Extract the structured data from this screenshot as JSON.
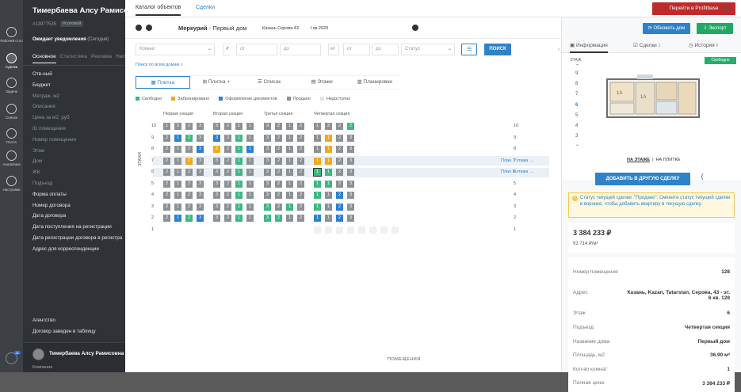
{
  "rail": [
    {
      "label": "Рабочий стол",
      "active": false
    },
    {
      "label": "Сделки",
      "active": true
    },
    {
      "label": "Задачи",
      "active": false
    },
    {
      "label": "Списки",
      "active": false
    },
    {
      "label": "Почта",
      "active": false
    },
    {
      "label": "Аналитика",
      "active": false
    },
    {
      "label": "Настройки",
      "active": false
    }
  ],
  "rail_badge": "31",
  "crm": {
    "name": "Тимербаева Алсу Рамисовна",
    "id": "#13977535",
    "tag": "#сотовой",
    "stage": "Ожидает уведомления",
    "stage_sub": "(Сегодня)",
    "tabs": [
      "Основное",
      "Статистика",
      "Реклама",
      "Нап"
    ],
    "fields": [
      "Отв-ный",
      "Бюджет",
      "Метраж, м2",
      "Описание",
      "Цена за м2, руб",
      "ID помещения",
      "Номер помещения",
      "Этаж",
      "Дом",
      "ЖК",
      "Подъезд",
      "Форма оплаты",
      "Номер договора",
      "Дата договора",
      "Дата поступления на регистрации",
      "Дата регистрации договора в регистра",
      "Адрес для корреспонденции"
    ],
    "fields_bottom": [
      "Агентство",
      "Договор заведен в таблицу"
    ],
    "bottom_user": "Тимербаева Алсу Рамисовна",
    "bottom_sub": "Компания"
  },
  "top": {
    "tabs": [
      "Каталог объектов",
      "Сделки"
    ],
    "profit_button": "Перейти в Profitbase"
  },
  "header": {
    "title": "Меркурий",
    "title_sub": "- Первый дом",
    "address": "Казань Серова 43",
    "quarter": "I кв 2020"
  },
  "filters": {
    "complex": "Комнат",
    "price_unit": "₽",
    "price_from": "от",
    "price_to": "до",
    "area_unit": "м²",
    "area_from": "от",
    "area_to": "до",
    "status": "Статус",
    "search": "ПОИСК",
    "search_all": "Поиск по всем домам"
  },
  "views": [
    "Плитка",
    "Плитка +",
    "Список",
    "Этажи",
    "Планировки"
  ],
  "legend": [
    {
      "label": "Свободно",
      "color": "#3db882"
    },
    {
      "label": "Забронировано",
      "color": "#f0a81e"
    },
    {
      "label": "Оформление документов",
      "color": "#2e7fd1"
    },
    {
      "label": "Продано",
      "color": "#8c9196"
    },
    {
      "label": "Недоступно",
      "color": "#dfe3e7"
    }
  ],
  "sections": [
    "Первая секция",
    "Вторая секция",
    "Третья секция",
    "Четвертая секция"
  ],
  "floors_axis": "ЭТАЖИ",
  "floors": [
    10,
    9,
    8,
    7,
    6,
    5,
    4,
    3,
    2,
    1
  ],
  "highlight_floors": [
    7,
    6
  ],
  "plans": [
    {
      "floor": 7,
      "text": "План",
      "num": "7",
      "suffix": "этажа"
    },
    {
      "floor": 6,
      "text": "План",
      "num": "6",
      "suffix": "этажа"
    }
  ],
  "chess_footer": "ПОМЕЩЕНИЯ",
  "units": {
    "10": [
      "s1g",
      "s2g",
      "s2g",
      "s3g",
      "s3g",
      "s2g",
      "s1g",
      "s1g",
      "s3g",
      "s2g",
      "s1g",
      "s2g",
      "s1g",
      "s2g",
      "s2g",
      "s2f"
    ],
    "9": [
      "s2g",
      "s1b",
      "s2f",
      "s3g",
      "s3b",
      "s2g",
      "s1f",
      "s1g",
      "s3g",
      "s2g",
      "s1g",
      "s2g",
      "s1g",
      "s1o",
      "s2g",
      "s3g"
    ],
    "8": [
      "s2g",
      "s1g",
      "s2g",
      "s3b",
      "s3o",
      "s2g",
      "s1f",
      "s1b",
      "s3g",
      "s2g",
      "s1g",
      "s2g",
      "s1g",
      "s1o",
      "s2g",
      "s3g"
    ],
    "7": [
      "s2g",
      "s1g",
      "s2o",
      "s3g",
      "s3g",
      "s2g",
      "s1f",
      "s1g",
      "s3g",
      "s2g",
      "s1g",
      "s2g",
      "s1o",
      "s1o",
      "s2g",
      "s3g"
    ],
    "6": [
      "s2g",
      "s1g",
      "s2g",
      "s3g",
      "s3g",
      "s2g",
      "s1f",
      "s1g",
      "s3g",
      "s2g",
      "s1g",
      "s2g",
      "s1x",
      "s1f",
      "s2g",
      "s3g"
    ],
    "5": [
      "s2g",
      "s1g",
      "s2g",
      "s3g",
      "s3g",
      "s2g",
      "s1f",
      "s1g",
      "s3g",
      "s2g",
      "s1g",
      "s2g",
      "s1f",
      "s1f",
      "s2g",
      "s3g"
    ],
    "4": [
      "s2g",
      "s1g",
      "s2g",
      "s3g",
      "s3g",
      "s2g",
      "s1f",
      "s1g",
      "s3g",
      "s2g",
      "s1g",
      "s2g",
      "s1f",
      "s1g",
      "s2b",
      "s3g"
    ],
    "3": [
      "s2g",
      "s1g",
      "s2g",
      "s3g",
      "s3g",
      "s2g",
      "s1f",
      "s1g",
      "s3f",
      "s2g",
      "s1f",
      "s2g",
      "s1f",
      "s1g",
      "s2b",
      "s3g"
    ],
    "2": [
      "s2g",
      "s1b",
      "s2f",
      "s3b",
      "s3g",
      "s2g",
      "s1f",
      "s1g",
      "s3f",
      "s2f",
      "s1g",
      "s2g",
      "s1b",
      "s1g",
      "s2b",
      "s3g"
    ]
  },
  "right": {
    "update_button": "Обновить дом",
    "export_button": "Экспорт",
    "tabs": [
      {
        "label": "Информация",
        "count": ""
      },
      {
        "label": "Сделки",
        "count": "1"
      },
      {
        "label": "История",
        "count": "6"
      }
    ],
    "floor_label": "ЭТАЖ",
    "floor_list": [
      "9",
      "8",
      "7",
      "6",
      "5",
      "4",
      "3"
    ],
    "current_floor": "6",
    "status_badge": "Свободно",
    "view_on_floor": "НА ЭТАЖЕ",
    "view_sep": "|",
    "view_on_tile": "НА ПЛИТКЕ",
    "add_button": "ДОБАВИТЬ В ДРУГУЮ СДЕЛКУ",
    "warning": "Статус текущей сделки: \"Продано\". Смените статус текущей сделки в воронке, чтобы добавить квартиру в текущую сделку.",
    "price": "3 384 233 ₽",
    "price_m2": "91 714 ₽/м²",
    "props": [
      {
        "k": "Номер помещения",
        "v": "128"
      },
      {
        "k": "Адрес",
        "v": "Казань, Kazan, Tatarstan, Серова, 43 - эт. 6 кв. 128"
      },
      {
        "k": "Этаж",
        "v": "6"
      },
      {
        "k": "Подъезд",
        "v": "Четвертая секция"
      },
      {
        "k": "Название дома",
        "v": "Первый дом"
      },
      {
        "k": "Площадь, м2",
        "v": "36.90 м²"
      },
      {
        "k": "Кол-во комнат",
        "v": "1"
      },
      {
        "k": "Полная цена",
        "v": "3 384 233 ₽"
      }
    ]
  },
  "colors": {
    "accent": "#2e82c7",
    "profit": "#c02a2a",
    "update": "#2e82c7",
    "export": "#22a862"
  }
}
